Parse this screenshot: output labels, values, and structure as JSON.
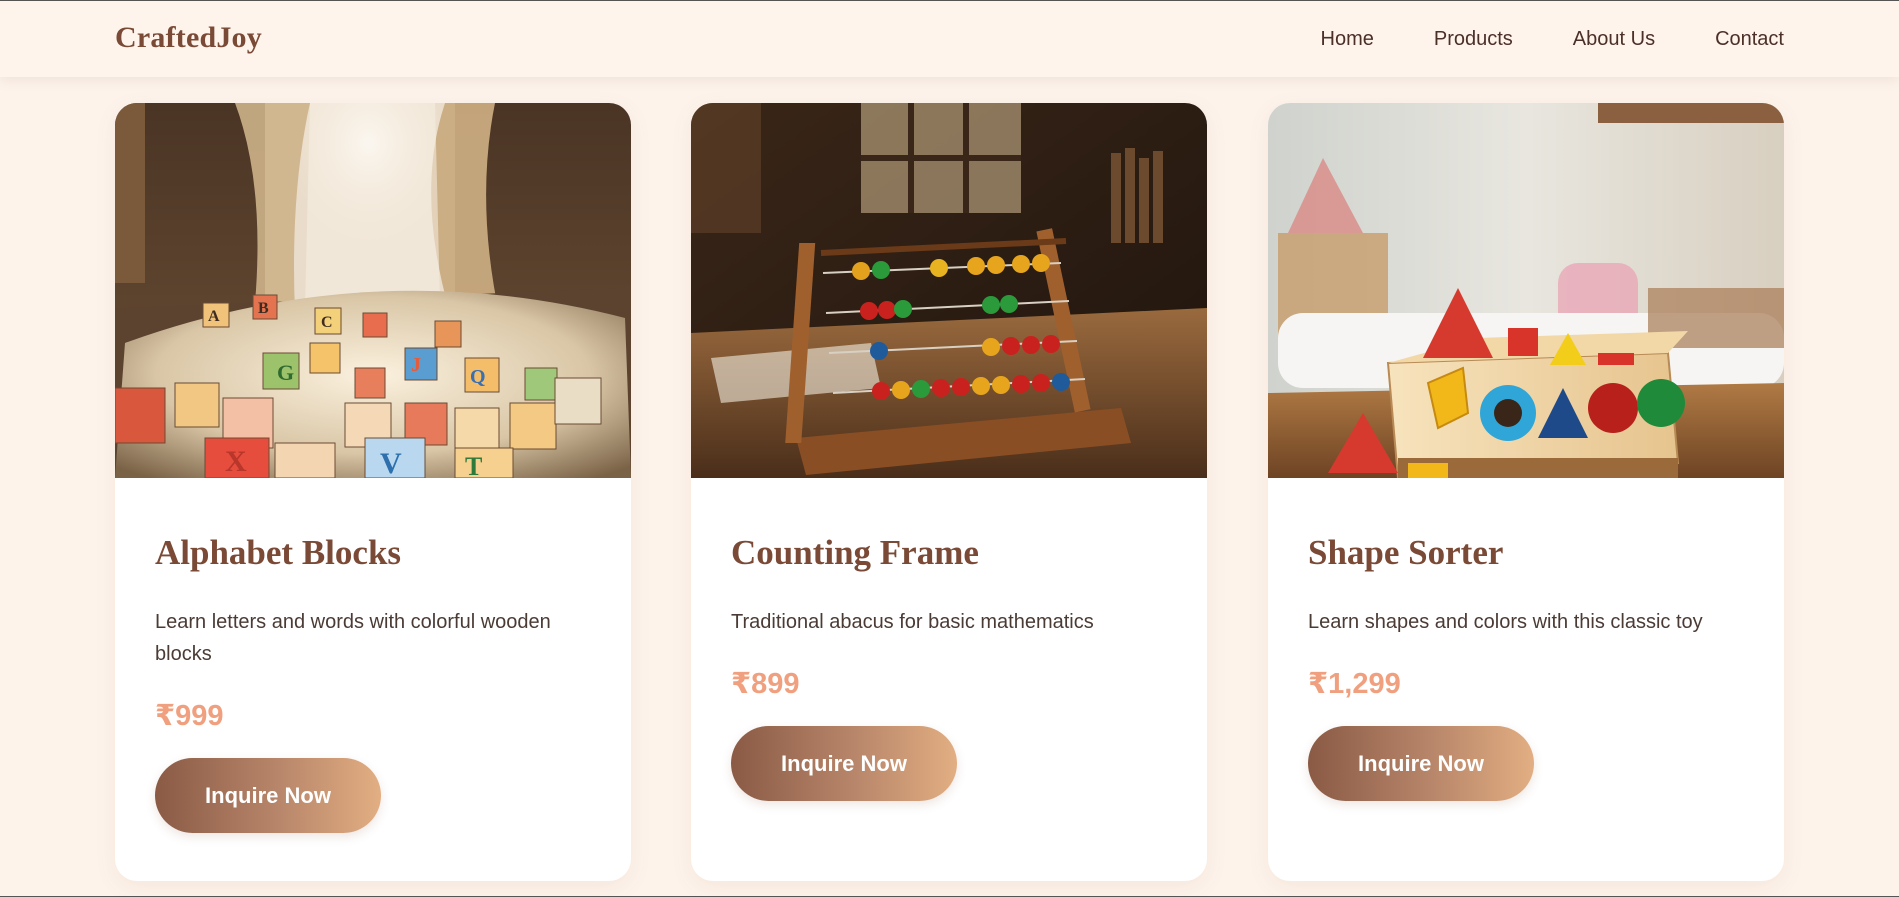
{
  "brand": {
    "logo": "CraftedJoy"
  },
  "nav": {
    "items": [
      "Home",
      "Products",
      "About Us",
      "Contact"
    ]
  },
  "products": [
    {
      "title": "Alphabet Blocks",
      "description": "Learn letters and words with colorful wooden blocks",
      "price": "₹999",
      "button_label": "Inquire Now",
      "image_icon": "alphabet-blocks-photo"
    },
    {
      "title": "Counting Frame",
      "description": "Traditional abacus for basic mathematics",
      "price": "₹899",
      "button_label": "Inquire Now",
      "image_icon": "abacus-photo"
    },
    {
      "title": "Shape Sorter",
      "description": "Learn shapes and colors with this classic toy",
      "price": "₹1,299",
      "button_label": "Inquire Now",
      "image_icon": "shape-sorter-photo"
    }
  ],
  "colors": {
    "background": "#fdf3eb",
    "header": "#fff4ec",
    "brand": "#7a4a36",
    "price": "#f0a07e",
    "button_start": "#8a5a45",
    "button_end": "#e2ae82"
  }
}
